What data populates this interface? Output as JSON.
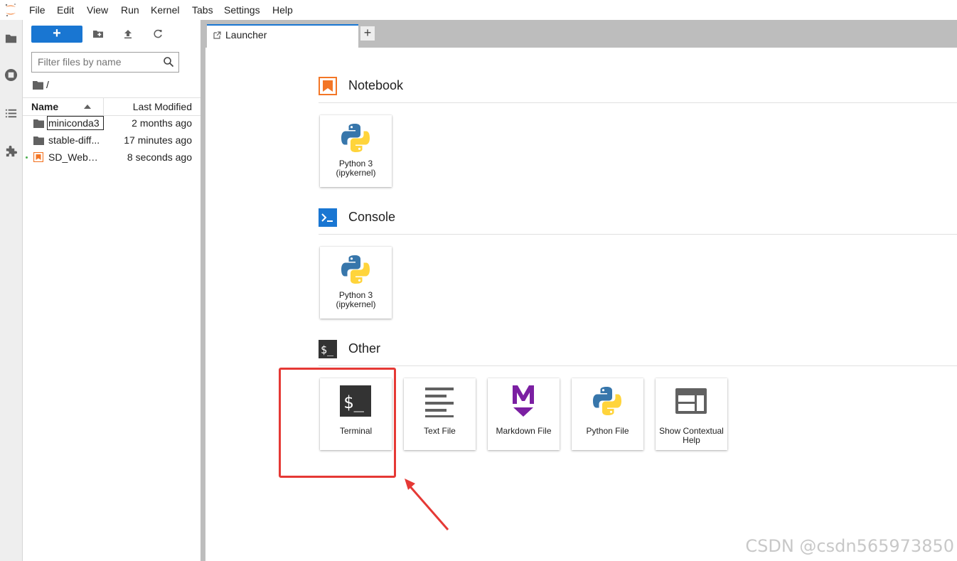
{
  "menubar": {
    "items": [
      "File",
      "Edit",
      "View",
      "Run",
      "Kernel",
      "Tabs",
      "Settings",
      "Help"
    ]
  },
  "activitybar": {
    "icons": [
      "folder-icon",
      "running-icon",
      "toc-icon",
      "extension-icon"
    ]
  },
  "filebrowser": {
    "new_label": "+",
    "filter_placeholder": "Filter files by name",
    "breadcrumb": "/",
    "columns": {
      "name": "Name",
      "modified": "Last Modified"
    },
    "files": [
      {
        "name": "miniconda3",
        "modified": "2 months ago",
        "type": "folder"
      },
      {
        "name": "stable-diff...",
        "modified": "17 minutes ago",
        "type": "folder"
      },
      {
        "name": "SD_WebUI...",
        "modified": "8 seconds ago",
        "type": "notebook"
      }
    ]
  },
  "tabs": {
    "items": [
      {
        "label": "Launcher"
      }
    ],
    "add_label": "+"
  },
  "launcher": {
    "sections": [
      {
        "title": "Notebook",
        "cards": [
          {
            "label": "Python 3 (ipykernel)"
          }
        ]
      },
      {
        "title": "Console",
        "cards": [
          {
            "label": "Python 3 (ipykernel)"
          }
        ]
      },
      {
        "title": "Other",
        "cards": [
          {
            "label": "Terminal"
          },
          {
            "label": "Text File"
          },
          {
            "label": "Markdown File"
          },
          {
            "label": "Python File"
          },
          {
            "label": "Show Contextual Help"
          }
        ]
      }
    ]
  },
  "colors": {
    "accent": "#1976d2",
    "notebook": "#f37626",
    "annotation": "#e53935",
    "markdown": "#7b1fa2"
  },
  "watermark": "CSDN @csdn565973850"
}
